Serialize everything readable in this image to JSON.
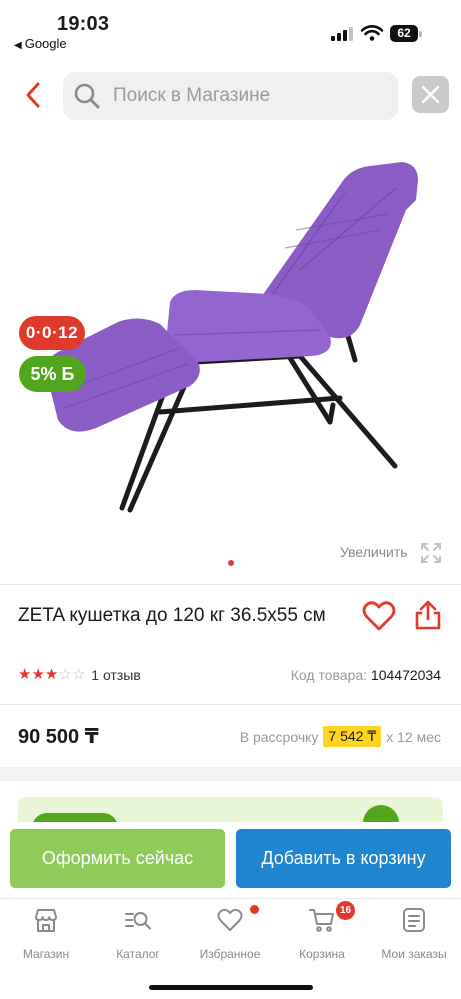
{
  "status_bar": {
    "time": "19:03",
    "back_app": "Google",
    "battery": "62"
  },
  "search": {
    "placeholder": "Поиск в Магазине"
  },
  "product": {
    "badges": {
      "installment": "0·0·12",
      "bonus": "5% Б"
    },
    "zoom_label": "Увеличить",
    "title": "ZETA кушетка до 120 кг 36.5х55 см",
    "rating_value": 3,
    "rating_max": 5,
    "reviews": "1 отзыв",
    "sku_label": "Код товара:",
    "sku_value": "104472034",
    "price": "90 500 ₸",
    "installment": {
      "prefix": "В рассрочку",
      "amount": "7 542 ₸",
      "suffix": "х 12 мес"
    },
    "image_color": "#8a5cc4"
  },
  "actions": {
    "buy_now": "Оформить сейчас",
    "add_to_cart": "Добавить в корзину"
  },
  "nav": {
    "items": [
      {
        "label": "Магазин",
        "icon": "shop-icon"
      },
      {
        "label": "Каталог",
        "icon": "catalog-search-icon"
      },
      {
        "label": "Избранное",
        "icon": "heart-icon"
      },
      {
        "label": "Корзина",
        "icon": "cart-icon",
        "badge": "16"
      },
      {
        "label": "Мои заказы",
        "icon": "orders-icon"
      }
    ]
  },
  "colors": {
    "accent_red": "#e03a2b",
    "green": "#52a61e",
    "buy_button": "#8ecb5a",
    "cart_button": "#1f85cf",
    "installment_highlight": "#ffd51f"
  }
}
